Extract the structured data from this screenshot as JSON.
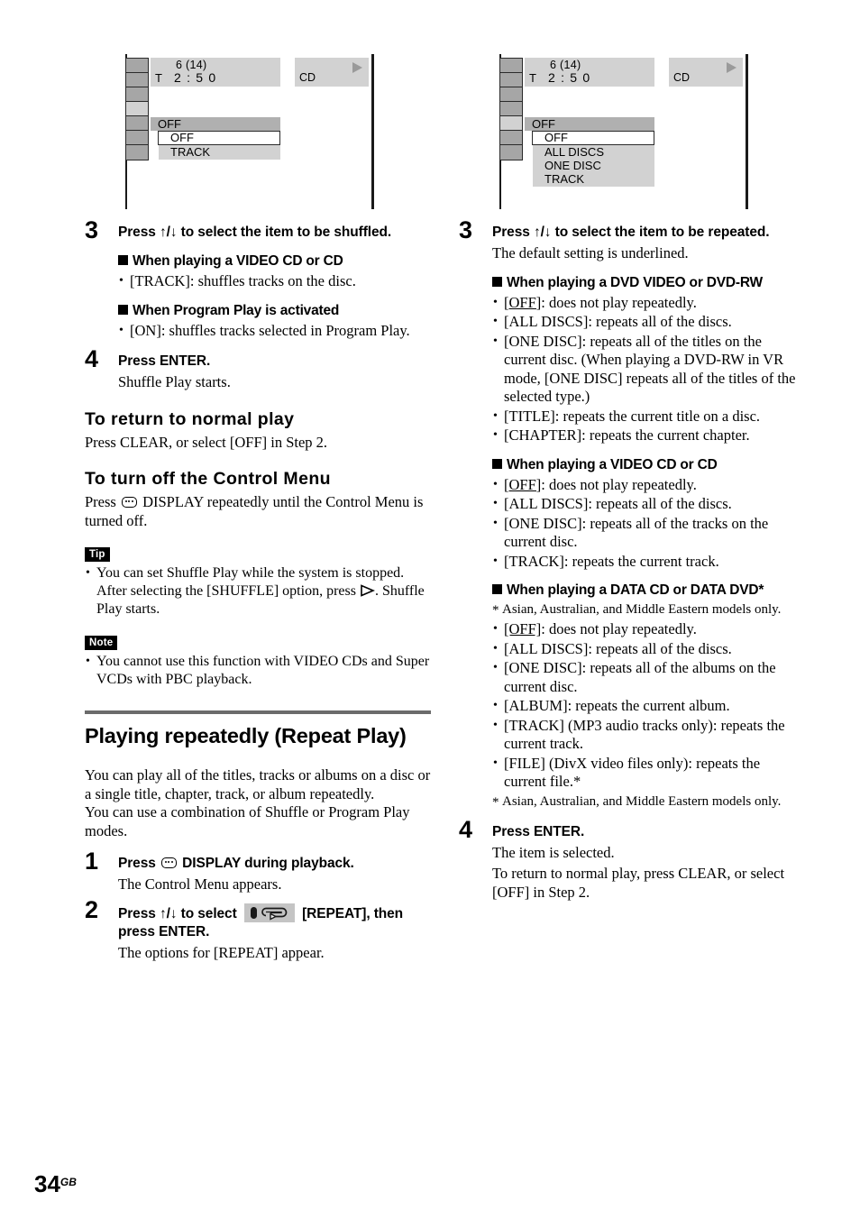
{
  "page": {
    "number": "34",
    "region_suffix": "GB"
  },
  "osd_left": {
    "name": "shuffle-osd",
    "info": {
      "track_of_total": "6 (14)",
      "time_prefix": "T",
      "time": "2 : 5 0"
    },
    "disc_label": "CD",
    "play_indicator": "play-triangle",
    "current_setting": "OFF",
    "options": [
      "OFF",
      "TRACK"
    ],
    "highlighted_option": "OFF",
    "sidebar_cells": 7,
    "selected_cell_index": 4
  },
  "osd_right": {
    "name": "repeat-osd",
    "info": {
      "track_of_total": "6 (14)",
      "time_prefix": "T",
      "time": "2 : 5 0"
    },
    "disc_label": "CD",
    "play_indicator": "play-triangle",
    "current_setting": "OFF",
    "options": [
      "OFF",
      "ALL DISCS",
      "ONE DISC",
      "TRACK"
    ],
    "highlighted_option": "OFF",
    "sidebar_cells": 7,
    "selected_cell_index": 5
  },
  "left_column": {
    "step3": {
      "number": "3",
      "title": "Press ↑/↓ to select the item to be shuffled.",
      "subsections": [
        {
          "heading": "When playing a VIDEO CD or CD",
          "items": [
            "[TRACK]: shuffles tracks on the disc."
          ]
        },
        {
          "heading": "When Program Play is activated",
          "items": [
            "[ON]: shuffles tracks selected in Program Play."
          ]
        }
      ]
    },
    "step4": {
      "number": "4",
      "title": "Press ENTER.",
      "desc": "Shuffle Play starts."
    },
    "section_return": {
      "heading": "To return to normal play",
      "body": "Press CLEAR, or select [OFF] in Step 2."
    },
    "section_turnoff": {
      "heading": "To turn off the Control Menu",
      "body_before_icon": "Press",
      "body_after_icon": "DISPLAY repeatedly until the Control Menu is turned off."
    },
    "tip": {
      "label": "Tip",
      "text_part1": "You can set Shuffle Play while the system is stopped. After selecting the [SHUFFLE] option, press",
      "text_part2": ". Shuffle Play starts."
    },
    "note": {
      "label": "Note",
      "text": "You cannot use this function with VIDEO CDs and Super VCDs with PBC playback."
    },
    "big_section": {
      "title": "Playing repeatedly (Repeat Play)",
      "intro_para1": "You can play all of the titles, tracks or albums on a disc or a single title, chapter, track, or album repeatedly.",
      "intro_para2": "You can use a combination of Shuffle or Program Play modes."
    },
    "step1": {
      "number": "1",
      "title_before_icon": "Press",
      "title_after_icon": "DISPLAY during playback.",
      "desc": "The Control Menu appears."
    },
    "step2": {
      "number": "2",
      "title_before_icon": "Press ↑/↓ to select",
      "title_after_icon": "[REPEAT], then press ENTER.",
      "desc": "The options for [REPEAT] appear."
    }
  },
  "right_column": {
    "step3": {
      "number": "3",
      "title": "Press ↑/↓ to select the item to be repeated.",
      "desc": "The default setting is underlined.",
      "subsections": [
        {
          "heading": "When playing a DVD VIDEO or DVD-RW",
          "items": [
            {
              "text": "[OFF]: does not play repeatedly.",
              "underline_token": "[OFF]"
            },
            {
              "text": "[ALL DISCS]: repeats all of the discs.",
              "underline_token": ""
            },
            {
              "text": "[ONE DISC]: repeats all of the titles on the current disc. (When playing a DVD-RW in VR mode, [ONE DISC] repeats all of the titles of the selected type.)",
              "underline_token": ""
            },
            {
              "text": "[TITLE]: repeats the current title on a disc.",
              "underline_token": ""
            },
            {
              "text": "[CHAPTER]: repeats the current chapter.",
              "underline_token": ""
            }
          ]
        },
        {
          "heading": "When playing a VIDEO CD or CD",
          "items": [
            {
              "text": "[OFF]: does not play repeatedly.",
              "underline_token": "[OFF]"
            },
            {
              "text": "[ALL DISCS]: repeats all of the discs.",
              "underline_token": ""
            },
            {
              "text": "[ONE DISC]: repeats all of the tracks on the current disc.",
              "underline_token": ""
            },
            {
              "text": "[TRACK]: repeats the current track.",
              "underline_token": ""
            }
          ]
        },
        {
          "heading": "When playing a DATA CD or DATA DVD*",
          "footnote_top": "Asian, Australian, and Middle Eastern models only.",
          "items": [
            {
              "text": "[OFF]: does not play repeatedly.",
              "underline_token": "[OFF]"
            },
            {
              "text": "[ALL DISCS]: repeats all of the discs.",
              "underline_token": ""
            },
            {
              "text": "[ONE DISC]: repeats all of the albums on the current disc.",
              "underline_token": ""
            },
            {
              "text": "[ALBUM]: repeats the current album.",
              "underline_token": ""
            },
            {
              "text": "[TRACK] (MP3 audio tracks only): repeats the current track.",
              "underline_token": ""
            },
            {
              "text": "[FILE] (DivX video files only): repeats the current file.*",
              "underline_token": ""
            }
          ],
          "footnote_bottom": "Asian, Australian, and Middle Eastern models only."
        }
      ]
    },
    "step4": {
      "number": "4",
      "title": "Press ENTER.",
      "desc1": "The item is selected.",
      "desc2": "To return to normal play, press CLEAR, or select [OFF] in Step 2."
    }
  },
  "colors": {
    "osd_band": "#d2d2d2",
    "osd_cell": "#a6a6a6",
    "osd_cell_selected": "#d2d2d2",
    "osd_current_row": "#b0b0b0",
    "rule": "#6b6b6b",
    "tag_bg": "#000000"
  }
}
